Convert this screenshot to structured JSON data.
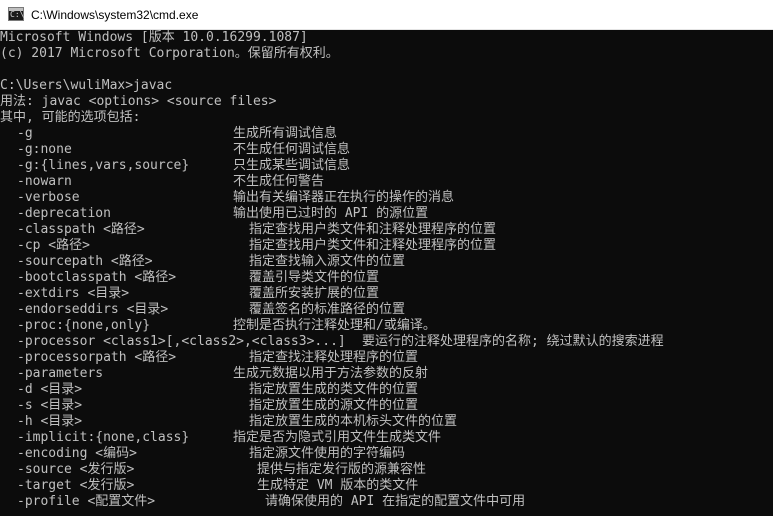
{
  "window": {
    "title": "C:\\Windows\\system32\\cmd.exe",
    "icon": "cmd-console-icon",
    "icon_glyph": "C:\\"
  },
  "colors": {
    "console_background": "#0c0c0c",
    "console_text": "#c0c0c0",
    "titlebar_background": "#ffffff"
  },
  "console": {
    "header_lines": [
      "Microsoft Windows [版本 10.0.16299.1087]",
      "(c) 2017 Microsoft Corporation。保留所有权利。",
      "",
      "C:\\Users\\wuliMax>javac",
      "用法: javac <options> <source files>",
      "其中, 可能的选项包括:"
    ],
    "options": [
      {
        "option": "-g",
        "description": "生成所有调试信息"
      },
      {
        "option": "-g:none",
        "description": "不生成任何调试信息"
      },
      {
        "option": "-g:{lines,vars,source}",
        "description": "只生成某些调试信息"
      },
      {
        "option": "-nowarn",
        "description": "不生成任何警告"
      },
      {
        "option": "-verbose",
        "description": "输出有关编译器正在执行的操作的消息"
      },
      {
        "option": "-deprecation",
        "description": "输出使用已过时的 API 的源位置"
      },
      {
        "option": "-classpath <路径>",
        "description": "指定查找用户类文件和注释处理程序的位置"
      },
      {
        "option": "-cp <路径>",
        "description": "指定查找用户类文件和注释处理程序的位置"
      },
      {
        "option": "-sourcepath <路径>",
        "description": "指定查找输入源文件的位置"
      },
      {
        "option": "-bootclasspath <路径>",
        "description": "覆盖引导类文件的位置"
      },
      {
        "option": "-extdirs <目录>",
        "description": "覆盖所安装扩展的位置"
      },
      {
        "option": "-endorseddirs <目录>",
        "description": "覆盖签名的标准路径的位置"
      },
      {
        "option": "-proc:{none,only}",
        "description": "控制是否执行注释处理和/或编译。"
      },
      {
        "option": "-processor <class1>[,<class2>,<class3>...]",
        "description": "要运行的注释处理程序的名称; 绕过默认的搜索进程"
      },
      {
        "option": "-processorpath <路径>",
        "description": "指定查找注释处理程序的位置"
      },
      {
        "option": "-parameters",
        "description": "生成元数据以用于方法参数的反射"
      },
      {
        "option": "-d <目录>",
        "description": "指定放置生成的类文件的位置"
      },
      {
        "option": "-s <目录>",
        "description": "指定放置生成的源文件的位置"
      },
      {
        "option": "-h <目录>",
        "description": "指定放置生成的本机标头文件的位置"
      },
      {
        "option": "-implicit:{none,class}",
        "description": "指定是否为隐式引用文件生成类文件"
      },
      {
        "option": "-encoding <编码>",
        "description": "指定源文件使用的字符编码"
      },
      {
        "option": "-source <发行版>",
        "description": "提供与指定发行版的源兼容性"
      },
      {
        "option": "-target <发行版>",
        "description": "生成特定 VM 版本的类文件"
      },
      {
        "option": "-profile <配置文件>",
        "description": "请确保使用的 API 在指定的配置文件中可用"
      }
    ]
  }
}
